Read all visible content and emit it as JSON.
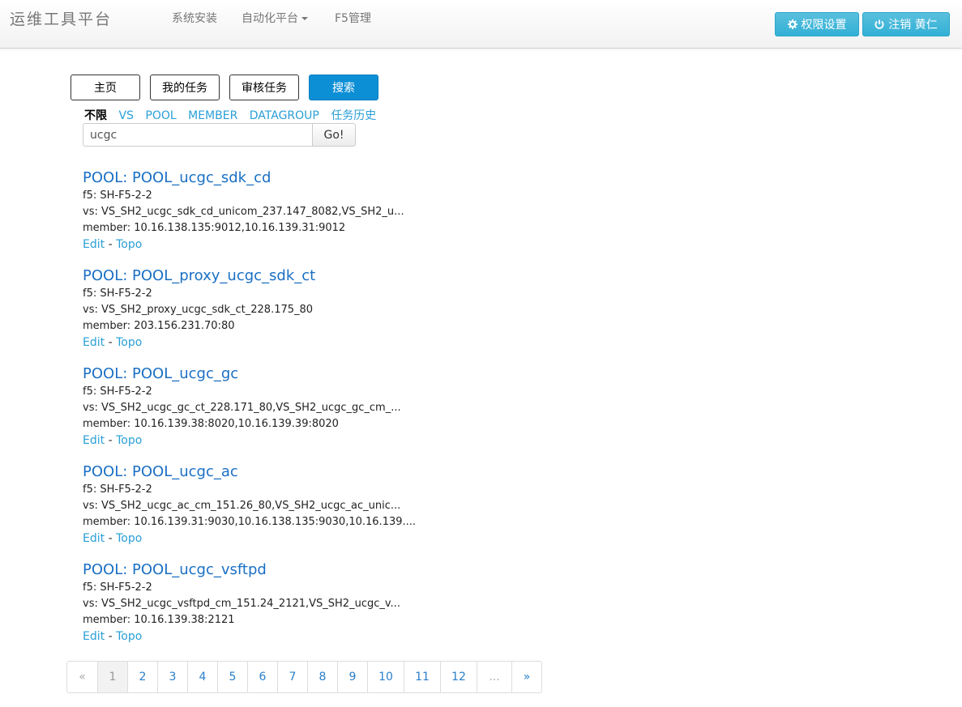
{
  "navbar": {
    "brand": "运维工具平台",
    "items": [
      "系统安装",
      "自动化平台",
      "F5管理"
    ],
    "perm_button": "权限设置",
    "logout_button": "注销 黄仁"
  },
  "tabs": [
    "主页",
    "我的任务",
    "审核任务",
    "搜索"
  ],
  "filters": [
    "不限",
    "VS",
    "POOL",
    "MEMBER",
    "DATAGROUP",
    "任务历史"
  ],
  "search": {
    "value": "ucgc",
    "go_label": "Go!"
  },
  "results": [
    {
      "title": "POOL: POOL_ucgc_sdk_cd",
      "f5": "f5: SH-F5-2-2",
      "vs": "vs: VS_SH2_ucgc_sdk_cd_unicom_237.147_8082,VS_SH2_u...",
      "member": "member: 10.16.138.135:9012,10.16.139.31:9012"
    },
    {
      "title": "POOL: POOL_proxy_ucgc_sdk_ct",
      "f5": "f5: SH-F5-2-2",
      "vs": "vs: VS_SH2_proxy_ucgc_sdk_ct_228.175_80",
      "member": "member: 203.156.231.70:80"
    },
    {
      "title": "POOL: POOL_ucgc_gc",
      "f5": "f5: SH-F5-2-2",
      "vs": "vs: VS_SH2_ucgc_gc_ct_228.171_80,VS_SH2_ucgc_gc_cm_...",
      "member": "member: 10.16.139.38:8020,10.16.139.39:8020"
    },
    {
      "title": "POOL: POOL_ucgc_ac",
      "f5": "f5: SH-F5-2-2",
      "vs": "vs: VS_SH2_ucgc_ac_cm_151.26_80,VS_SH2_ucgc_ac_unic...",
      "member": "member: 10.16.139.31:9030,10.16.138.135:9030,10.16.139...."
    },
    {
      "title": "POOL: POOL_ucgc_vsftpd",
      "f5": "f5: SH-F5-2-2",
      "vs": "vs: VS_SH2_ucgc_vsftpd_cm_151.24_2121,VS_SH2_ucgc_v...",
      "member": "member: 10.16.139.38:2121"
    }
  ],
  "result_links": {
    "edit": "Edit",
    "sep": "-",
    "topo": "Topo"
  },
  "pagination": [
    "«",
    "1",
    "2",
    "3",
    "4",
    "5",
    "6",
    "7",
    "8",
    "9",
    "10",
    "11",
    "12",
    "...",
    "»"
  ],
  "colors": {
    "accent": "#0d8fd6",
    "info_button": "#5bc0de",
    "link": "#1a6fc4"
  }
}
